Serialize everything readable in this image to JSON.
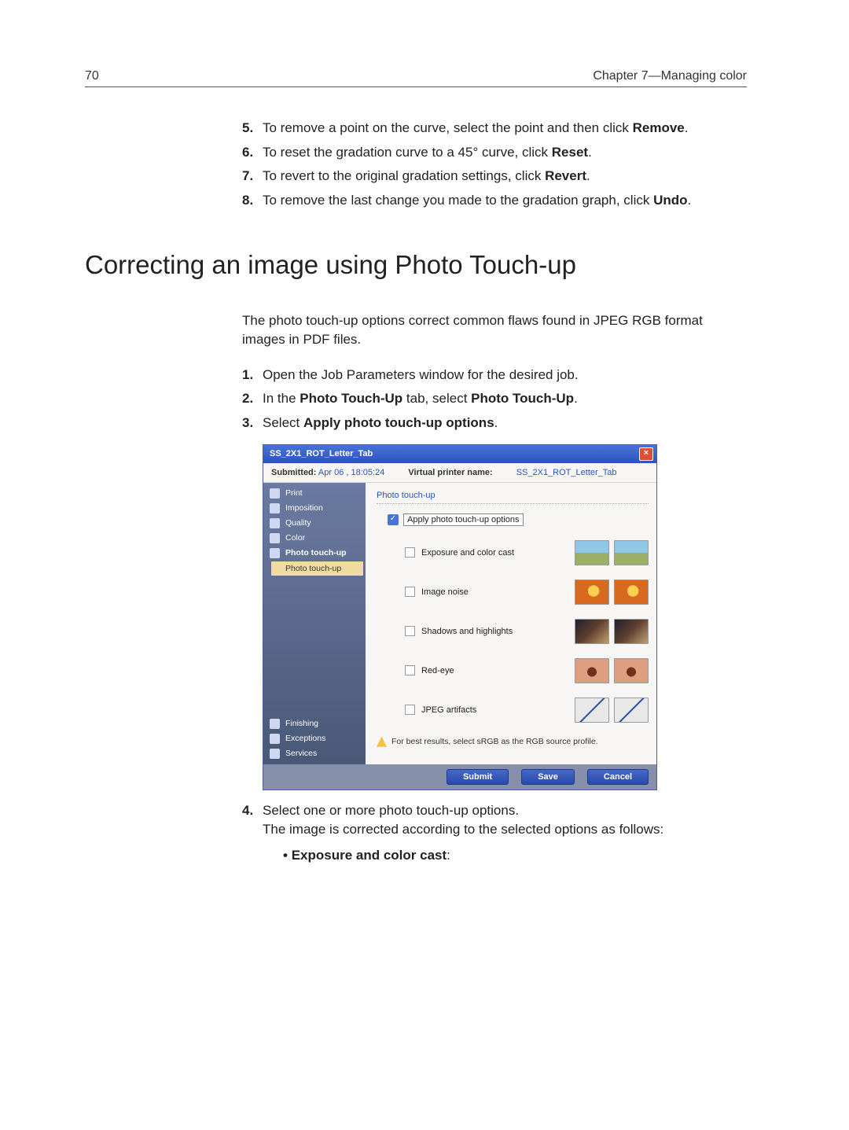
{
  "header": {
    "page_number": "70",
    "chapter": "Chapter 7—Managing color"
  },
  "top_steps": [
    {
      "n": "5.",
      "pre": "To remove a point on the curve, select the point and then click ",
      "b": "Remove",
      "post": "."
    },
    {
      "n": "6.",
      "pre": "To reset the gradation curve to a 45° curve, click ",
      "b": "Reset",
      "post": "."
    },
    {
      "n": "7.",
      "pre": "To revert to the original gradation settings, click ",
      "b": "Revert",
      "post": "."
    },
    {
      "n": "8.",
      "pre": "To remove the last change you made to the gradation graph, click ",
      "b": "Undo",
      "post": "."
    }
  ],
  "section_title": "Correcting an image using Photo Touch-up",
  "intro": "The photo touch-up options correct common flaws found in JPEG RGB format images in PDF files.",
  "mid_steps": {
    "s1": {
      "n": "1.",
      "text": "Open the Job Parameters window for the desired job."
    },
    "s2": {
      "n": "2.",
      "pre": "In the ",
      "b1": "Photo Touch-Up",
      "mid": " tab, select ",
      "b2": "Photo Touch-Up",
      "post": "."
    },
    "s3": {
      "n": "3.",
      "pre": "Select ",
      "b": "Apply photo touch-up options",
      "post": "."
    }
  },
  "dialog": {
    "title": "SS_2X1_ROT_Letter_Tab",
    "close": "×",
    "submitted_label": "Submitted:",
    "submitted_value": "Apr 06 , 18:05:24",
    "vpn_label": "Virtual printer name:",
    "vpn_value": "SS_2X1_ROT_Letter_Tab",
    "sidebar_top": [
      "Print",
      "Imposition",
      "Quality",
      "Color",
      "Photo touch-up"
    ],
    "sidebar_sub": "Photo touch-up",
    "sidebar_bottom": [
      "Finishing",
      "Exceptions",
      "Services"
    ],
    "pane_heading": "Photo touch-up",
    "apply_label": "Apply photo touch-up options",
    "options": [
      "Exposure and color cast",
      "Image noise",
      "Shadows and highlights",
      "Red-eye",
      "JPEG artifacts"
    ],
    "hint": "For best results, select sRGB as the RGB source profile.",
    "buttons": {
      "submit": "Submit",
      "save": "Save",
      "cancel": "Cancel"
    }
  },
  "step4": {
    "n": "4.",
    "line1": "Select one or more photo touch-up options.",
    "line2": "The image is corrected according to the selected options as follows:"
  },
  "bullet1": "Exposure and color cast",
  "colon": ":"
}
